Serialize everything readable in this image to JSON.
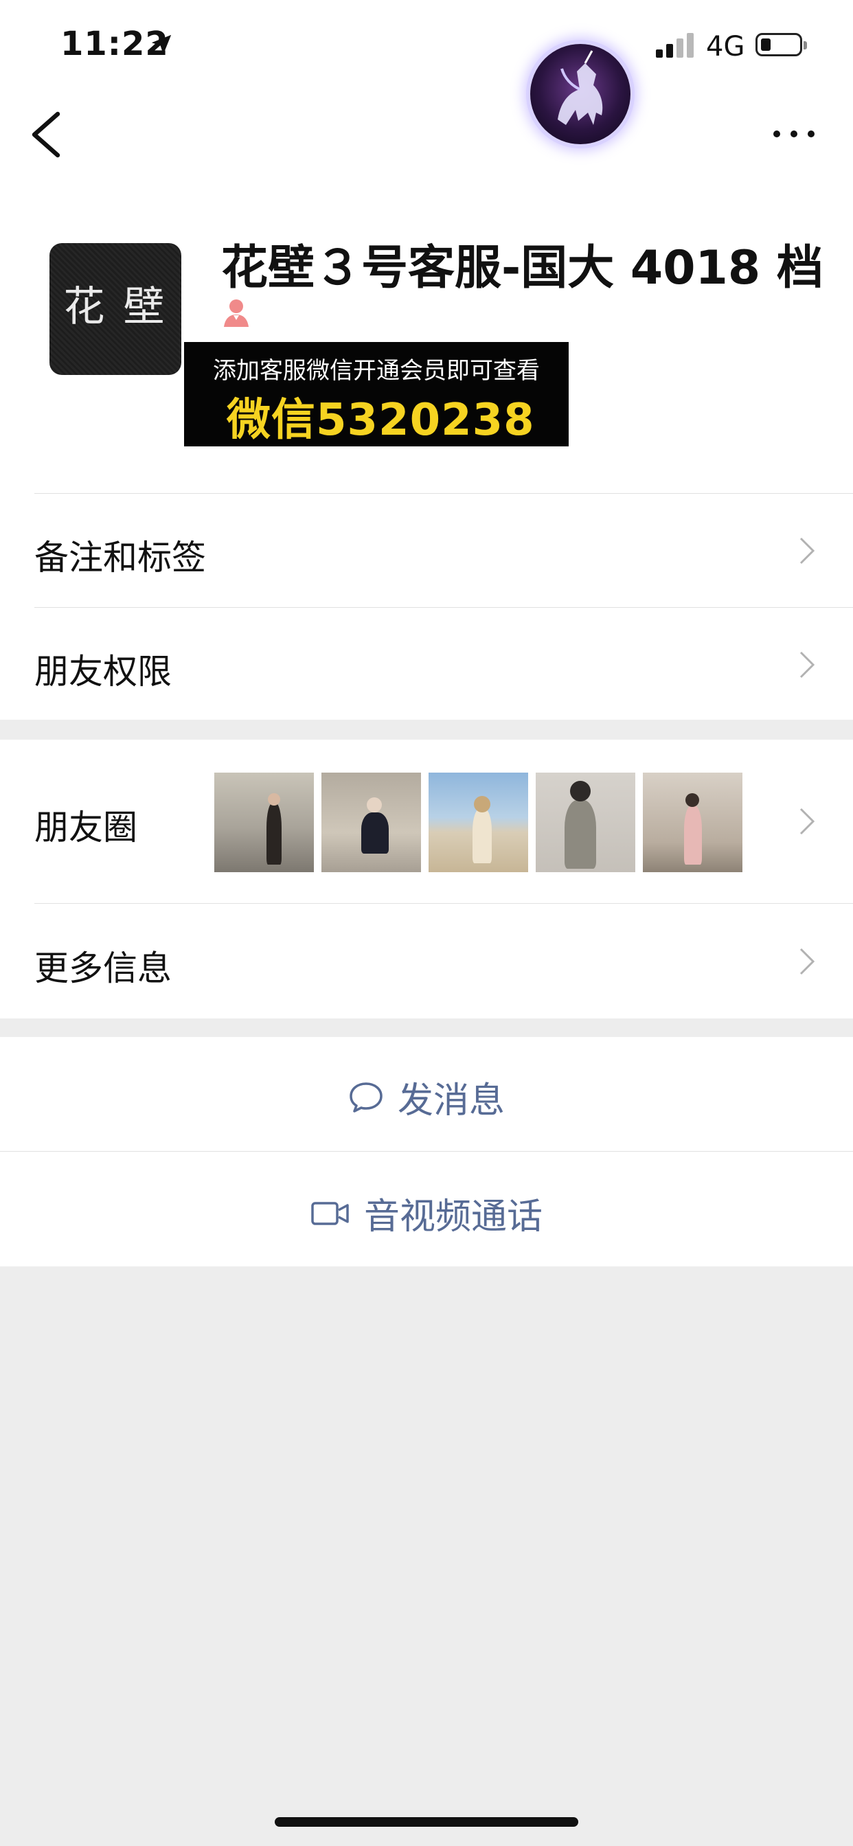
{
  "status_bar": {
    "time": "11:22",
    "network": "4G",
    "signal_bars_active": 2,
    "signal_bars_total": 4
  },
  "nav": {
    "back_icon": "chevron-left-icon",
    "more_icon": "ellipsis-icon"
  },
  "profile": {
    "name": "花壁３号客服-国大 4018 档",
    "avatar_text": "花 壁",
    "gender_icon": "female-person-icon",
    "promo_line1": "添加客服微信开通会员即可查看",
    "promo_line2": "微信5320238"
  },
  "rows": {
    "remark_tags": "备注和标签",
    "friend_permissions": "朋友权限",
    "moments": "朋友圈",
    "more_info": "更多信息"
  },
  "actions": {
    "send_message": "发消息",
    "av_call": "音视频通话"
  },
  "colors": {
    "link_blue": "#576b95",
    "promo_yellow": "#f6d321",
    "page_gray": "#ededed",
    "chevron_gray": "#b2b2b2"
  }
}
